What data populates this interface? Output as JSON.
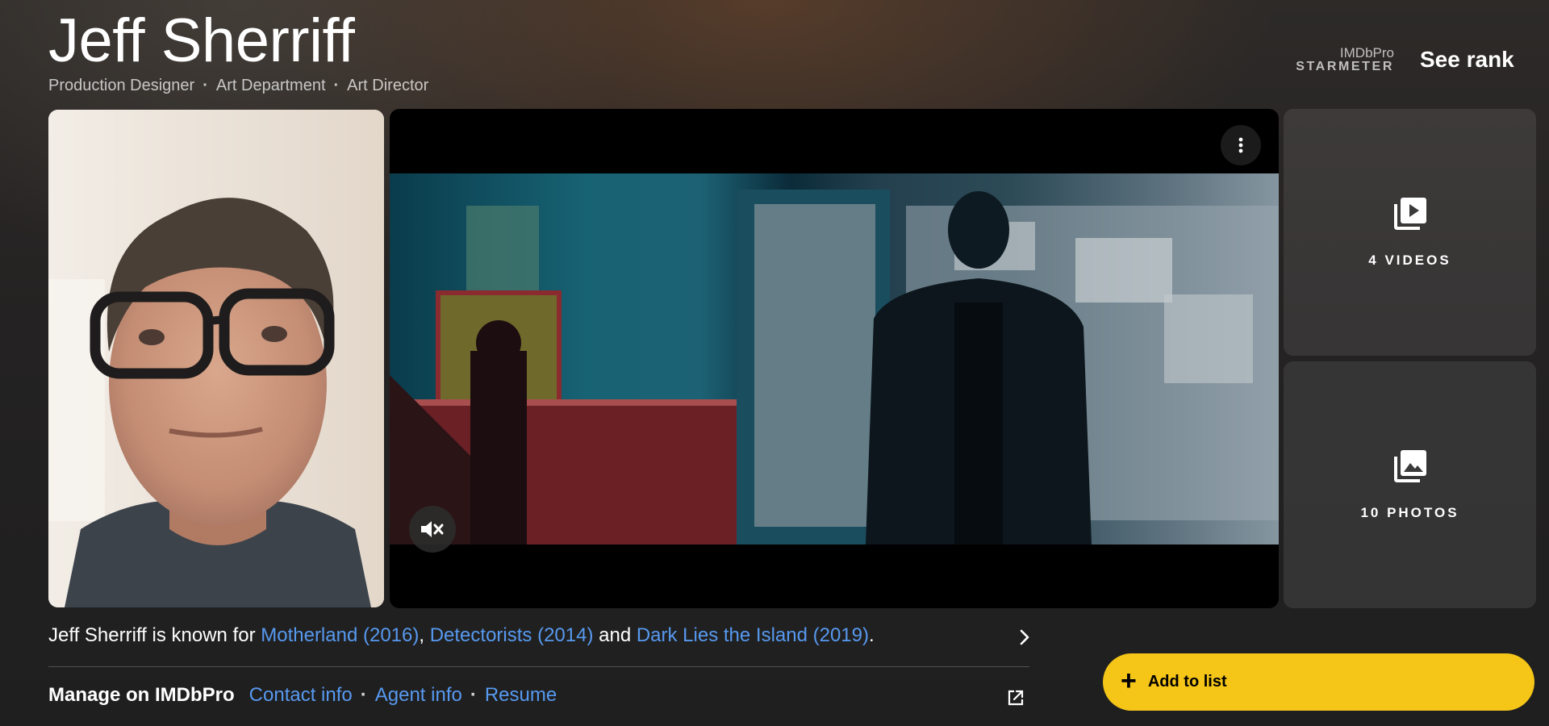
{
  "header": {
    "name": "Jeff Sherriff",
    "roles": [
      "Production Designer",
      "Art Department",
      "Art Director"
    ],
    "role_separator": "·",
    "starmeter_pro": "IMDbPro",
    "starmeter_label": "STARMETER",
    "see_rank": "See rank"
  },
  "media": {
    "videos_label": "4 VIDEOS",
    "photos_label": "10 PHOTOS"
  },
  "known_for": {
    "prefix": "Jeff Sherriff is known for ",
    "title_1": "Motherland (2016)",
    "sep_1": ", ",
    "title_2": "Detectorists (2014)",
    "sep_2": " and ",
    "title_3": "Dark Lies the Island (2019)",
    "suffix": "."
  },
  "manage": {
    "label": "Manage on IMDbPro",
    "links": [
      "Contact info",
      "Agent info",
      "Resume"
    ],
    "separator": "·"
  },
  "add_to_list": {
    "icon": "+",
    "label": "Add to list"
  },
  "colors": {
    "link": "#5799ef",
    "accent": "#f5c518"
  }
}
